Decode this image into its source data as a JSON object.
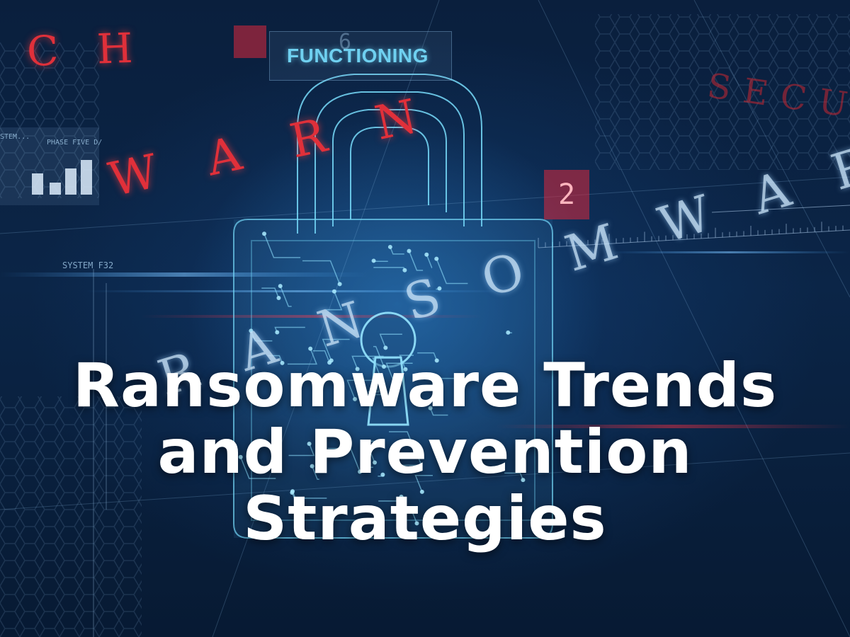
{
  "headline": {
    "line1": "Ransomware Trends",
    "line2": "and Prevention",
    "line3": "Strategies"
  },
  "background_text": {
    "ch": "C H",
    "warn": "W A R N",
    "ransomware": "R A N S O M W A R E",
    "secu": "SECU",
    "functioning": "FUNCTIONING",
    "system": "SYSTEM F32",
    "phase": "PHASE FIVE D/",
    "stem": "STEM...",
    "number_box": "2",
    "digit_six": "6"
  },
  "colors": {
    "accent_red": "#e0303a",
    "accent_cyan": "#6fd0f0",
    "headline": "#ffffff",
    "background": "#0b2547"
  }
}
